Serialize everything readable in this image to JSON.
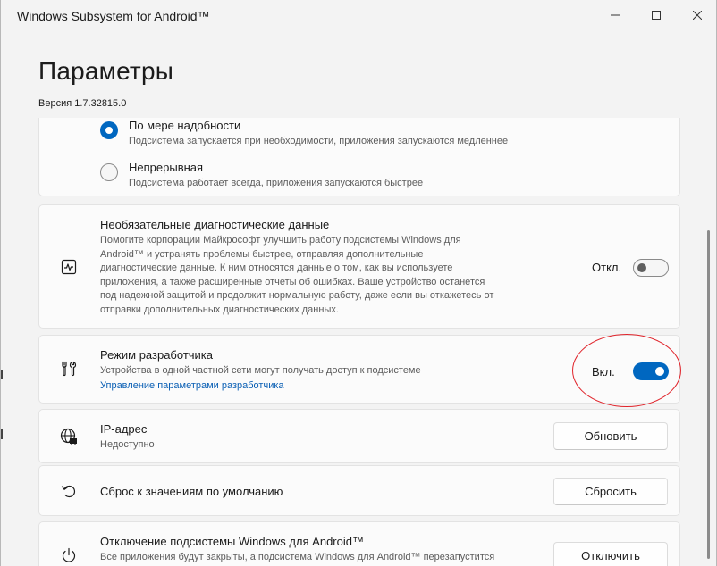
{
  "window": {
    "title": "Windows Subsystem for Android™",
    "minimize_icon": "minimize-icon",
    "maximize_icon": "maximize-icon",
    "close_icon": "close-icon"
  },
  "header": {
    "title": "Параметры",
    "version": "Версия 1.7.32815.0"
  },
  "resources": {
    "options": [
      {
        "label": "По мере надобности",
        "description": "Подсистема запускается при необходимости, приложения запускаются медленнее",
        "selected": true
      },
      {
        "label": "Непрерывная",
        "description": "Подсистема работает всегда, приложения запускаются быстрее",
        "selected": false
      }
    ]
  },
  "diagnostics": {
    "icon": "activity-monitor-icon",
    "title": "Необязательные диагностические данные",
    "description_lines": [
      "Помогите корпорации Майкрософт улучшить работу подсистемы Windows для",
      "Android™ и устранять проблемы быстрее, отправляя дополнительные",
      "диагностические данные. К ним относятся данные о том, как вы используете",
      "приложения, а также расширенные отчеты об ошибках. Ваше устройство останется",
      "под надежной защитой и продолжит нормальную работу, даже если вы откажетесь от",
      "отправки дополнительных диагностических данных."
    ],
    "toggle_label": "Откл.",
    "toggle_on": false
  },
  "developer_mode": {
    "icon": "developer-tools-icon",
    "title": "Режим разработчика",
    "description": "Устройства в одной частной сети могут получать доступ к подсистеме",
    "link": "Управление параметрами разработчика",
    "toggle_label": "Вкл.",
    "toggle_on": true,
    "highlight_color": "#e0242b"
  },
  "ip_address": {
    "icon": "network-globe-icon",
    "title": "IP-адрес",
    "value": "Недоступно",
    "button": "Обновить"
  },
  "reset": {
    "icon": "reset-icon",
    "title": "Сброс к значениям по умолчанию",
    "button": "Сбросить"
  },
  "shutdown": {
    "icon": "power-icon",
    "title": "Отключение подсистемы Windows для Android™",
    "description": "Все приложения будут закрыты, а подсистема Windows для Android™ перезапустится",
    "button": "Отключить"
  },
  "colors": {
    "accent": "#0067c0",
    "link": "#0a5fb4",
    "annotation": "#e0242b"
  }
}
